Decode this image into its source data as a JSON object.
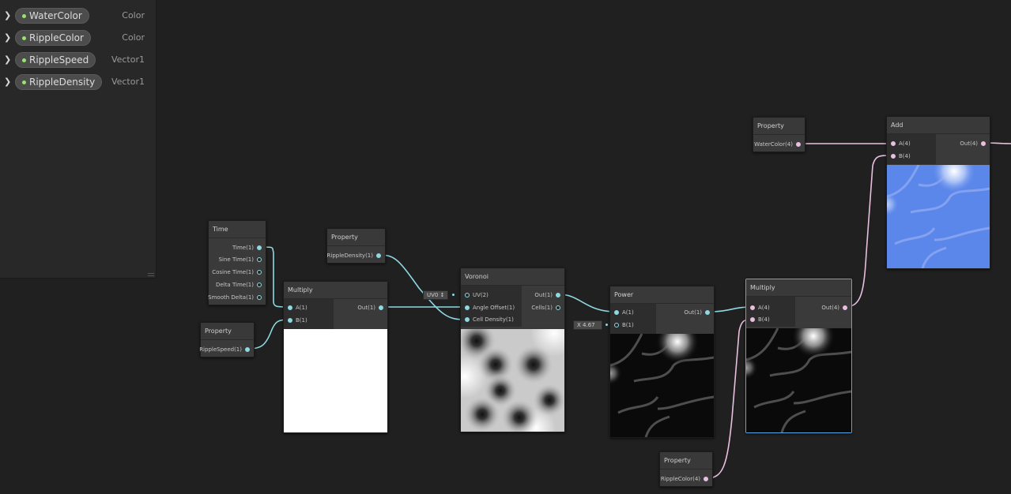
{
  "blackboard": {
    "properties": [
      {
        "name": "WaterColor",
        "type": "Color"
      },
      {
        "name": "RippleColor",
        "type": "Color"
      },
      {
        "name": "RippleSpeed",
        "type": "Vector1"
      },
      {
        "name": "RippleDensity",
        "type": "Vector1"
      }
    ]
  },
  "nodes": {
    "time": {
      "title": "Time",
      "outputs": [
        "Time(1)",
        "Sine Time(1)",
        "Cosine Time(1)",
        "Delta Time(1)",
        "Smooth Delta(1)"
      ]
    },
    "prop_ripple_speed": {
      "title": "Property",
      "output": "RippleSpeed(1)"
    },
    "multiply1": {
      "title": "Multiply",
      "in_a": "A(1)",
      "in_b": "B(1)",
      "out": "Out(1)"
    },
    "prop_ripple_density": {
      "title": "Property",
      "output": "RippleDensity(1)"
    },
    "voronoi": {
      "title": "Voronoi",
      "uv_field": "UV0 ↕",
      "in_uv": "UV(2)",
      "in_angle": "Angle Offset(1)",
      "in_density": "Cell Density(1)",
      "out": "Out(1)",
      "cells": "Cells(1)"
    },
    "power": {
      "title": "Power",
      "in_a": "A(1)",
      "in_b": "B(1)",
      "out": "Out(1)",
      "b_field": "X 4.67"
    },
    "multiply2": {
      "title": "Multiply",
      "in_a": "A(4)",
      "in_b": "B(4)",
      "out": "Out(4)"
    },
    "prop_water_color": {
      "title": "Property",
      "output": "WaterColor(4)"
    },
    "prop_ripple_color": {
      "title": "Property",
      "output": "RippleColor(4)"
    },
    "add": {
      "title": "Add",
      "in_a": "A(4)",
      "in_b": "B(4)",
      "out": "Out(4)"
    }
  },
  "colors": {
    "float_wire": "#8ed9e2",
    "vector4_wire": "#e9bfe0",
    "selection": "#5aa7e6",
    "water": "#5b86ea"
  }
}
